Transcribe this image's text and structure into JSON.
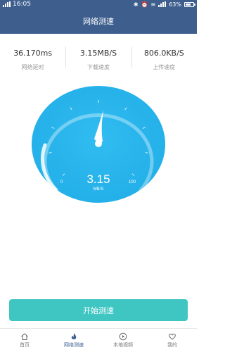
{
  "statusbar": {
    "time": "16:05",
    "battery": "63%"
  },
  "header": {
    "title": "网络测速"
  },
  "metrics": [
    {
      "value": "36.170ms",
      "label": "网络延时"
    },
    {
      "value": "3.15MB/S",
      "label": "下载速度"
    },
    {
      "value": "806.0KB/S",
      "label": "上传速度"
    }
  ],
  "gauge": {
    "value": "3.15",
    "unit": "MB/S",
    "min_label": "0",
    "max_label": "100",
    "speed": 3.15
  },
  "start_button": {
    "label": "开始测速"
  },
  "tabs": [
    {
      "label": "首页",
      "icon": "home-icon"
    },
    {
      "label": "网络测速",
      "icon": "flame-icon"
    },
    {
      "label": "本地视频",
      "icon": "play-icon"
    },
    {
      "label": "我的",
      "icon": "heart-icon"
    }
  ],
  "colors": {
    "accent": "#3e5f8e",
    "button": "#3fc6c3",
    "gauge": "#2bb5ec"
  }
}
